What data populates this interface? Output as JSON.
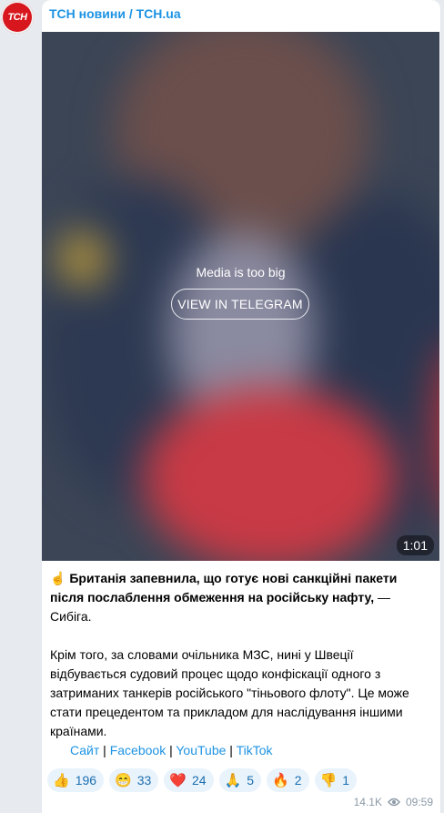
{
  "channel": {
    "name": "ТСН новини / ТСН.ua",
    "avatar_text": "ТСН"
  },
  "media": {
    "message": "Media is too big",
    "button_label": "VIEW IN TELEGRAM",
    "duration": "1:01"
  },
  "post": {
    "emoji": "☝️",
    "headline_bold": "Британія запевнила, що готує нові санкційні пакети після послаблення обмеження на російську нафту,",
    "headline_rest": " — Сибіга.",
    "paragraph": "Крім того, за словами очільника МЗС, нині у Швеції відбувається судовий процес щодо конфіскації одного з затриманих танкерів російського \"тіньового флоту\". Це може стати прецедентом та прикладом для наслідування іншими країнами."
  },
  "links": [
    {
      "label": "Сайт"
    },
    {
      "label": "Facebook"
    },
    {
      "label": "YouTube"
    },
    {
      "label": "TikTok"
    }
  ],
  "link_separator": " | ",
  "reactions": [
    {
      "emoji": "👍",
      "icon": "thumbs-up",
      "count": "196"
    },
    {
      "emoji": "😁",
      "icon": "grin",
      "count": "33"
    },
    {
      "emoji": "❤️",
      "icon": "heart",
      "count": "24"
    },
    {
      "emoji": "🙏",
      "icon": "pray",
      "count": "5"
    },
    {
      "emoji": "🔥",
      "icon": "fire",
      "count": "2"
    },
    {
      "emoji": "👎",
      "icon": "thumbs-down",
      "count": "1"
    }
  ],
  "meta": {
    "views": "14.1K",
    "time": "09:59"
  },
  "colors": {
    "accent": "#1c93e3",
    "avatar_bg": "#d8161d",
    "reaction_bg": "#e9f3fc"
  }
}
